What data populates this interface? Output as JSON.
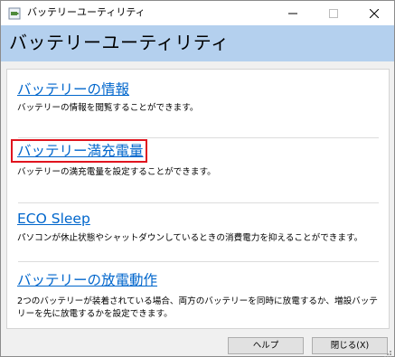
{
  "window": {
    "title": "バッテリーユーティリティ",
    "icons": {
      "app": "battery-app-icon",
      "minimize": "minimize-icon",
      "maximize": "maximize-icon",
      "close": "close-icon",
      "grip": "resize-grip-icon"
    }
  },
  "banner": {
    "title": "バッテリーユーティリティ"
  },
  "items": [
    {
      "title": "バッテリーの情報",
      "description": "バッテリーの情報を閲覧することができます。"
    },
    {
      "title": "バッテリー満充電量",
      "description": "バッテリーの満充電量を設定することができます。"
    },
    {
      "title": "ECO Sleep",
      "description": "パソコンが休止状態やシャットダウンしているときの消費電力を抑えることができます。"
    },
    {
      "title": "バッテリーの放電動作",
      "description": "2つのバッテリーが装着されている場合、両方のバッテリーを同時に放電するか、増設バッテリーを先に放電するかを設定できます。"
    }
  ],
  "buttons": {
    "help": "ヘルプ",
    "close": "閉じる(X)"
  },
  "colors": {
    "banner": "#b4d0ee",
    "link": "#0066cc",
    "highlight": "#e0141e"
  }
}
